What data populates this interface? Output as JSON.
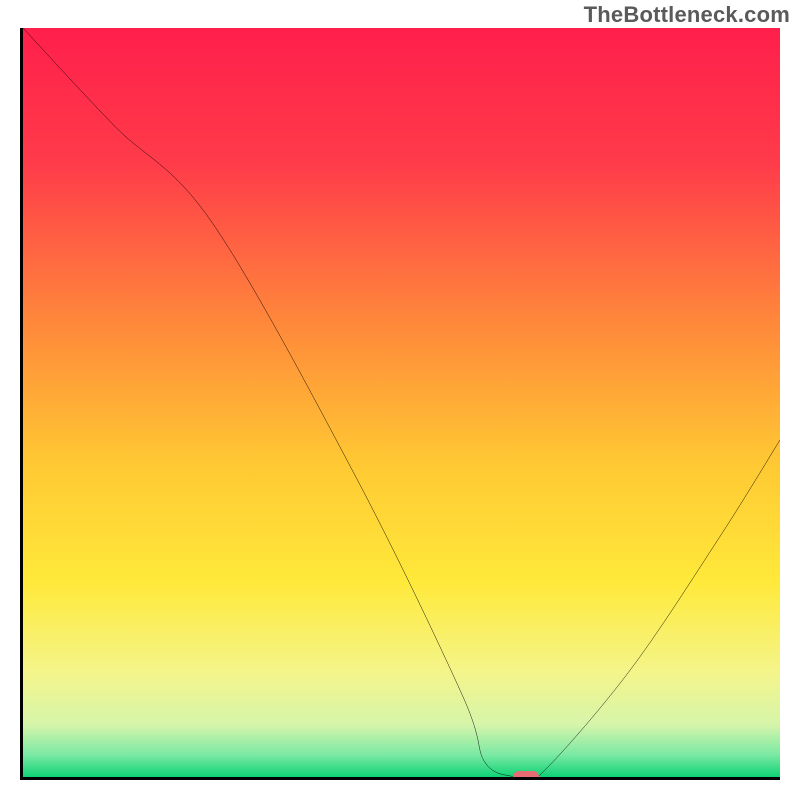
{
  "watermark": "TheBottleneck.com",
  "chart_data": {
    "type": "line",
    "title": "",
    "xlabel": "",
    "ylabel": "",
    "xlim": [
      0,
      100
    ],
    "ylim": [
      0,
      100
    ],
    "series": [
      {
        "name": "bottleneck-curve",
        "x": [
          0,
          12,
          25,
          44,
          58,
          61,
          65,
          68,
          80,
          92,
          100
        ],
        "values": [
          100,
          87,
          74,
          40,
          11,
          2,
          0,
          0,
          14,
          32,
          45
        ]
      }
    ],
    "marker": {
      "x": 66.5,
      "y": 0
    },
    "gradient_stops": [
      {
        "offset": 0,
        "color": "#ff1f4b"
      },
      {
        "offset": 18,
        "color": "#ff3b4a"
      },
      {
        "offset": 40,
        "color": "#ff8a3a"
      },
      {
        "offset": 58,
        "color": "#ffc833"
      },
      {
        "offset": 74,
        "color": "#ffe93a"
      },
      {
        "offset": 86,
        "color": "#f4f58a"
      },
      {
        "offset": 93,
        "color": "#d6f5aa"
      },
      {
        "offset": 97,
        "color": "#7ce9a4"
      },
      {
        "offset": 100,
        "color": "#0fd276"
      }
    ]
  }
}
